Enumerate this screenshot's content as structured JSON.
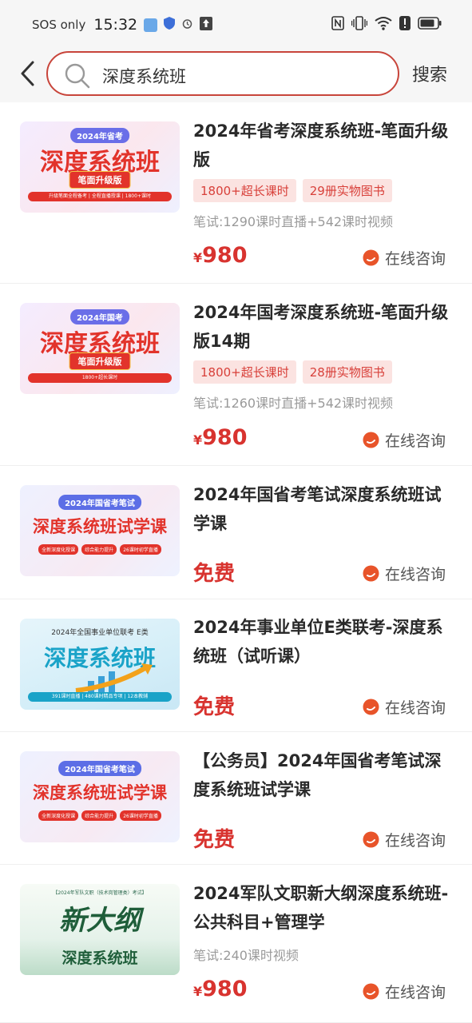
{
  "status_bar": {
    "carrier": "SOS only",
    "time": "15:32"
  },
  "search": {
    "query": "深度系统班",
    "button": "搜索"
  },
  "courses": [
    {
      "title": "2024年省考深度系统班-笔面升级版",
      "tags": [
        "1800+超长课时",
        "29册实物图书"
      ],
      "desc": "笔试:1290课时直播+542课时视频",
      "price_symbol": "¥",
      "price": "980",
      "consult": "在线咨询",
      "thumb": {
        "badge": "2024年省考",
        "headline": "深度系统班",
        "ribbon": "笔面升级版",
        "strip": "升级笔面全程备考 | 全程直播授课 | 1800+课时"
      }
    },
    {
      "title": "2024年国考深度系统班-笔面升级版14期",
      "tags": [
        "1800+超长课时",
        "28册实物图书"
      ],
      "desc": "笔试:1260课时直播+542课时视频",
      "price_symbol": "¥",
      "price": "980",
      "consult": "在线咨询",
      "thumb": {
        "badge": "2024年国考",
        "headline": "深度系统班",
        "ribbon": "笔面升级版",
        "strip": "1800+超长课时"
      }
    },
    {
      "title": "2024年国省考笔试深度系统班试学课",
      "price": "免费",
      "consult": "在线咨询",
      "thumb": {
        "badge": "2024年国省考笔试",
        "headline": "深度系统班试学课",
        "pills": [
          "全新深度化授课",
          "综合能力提升",
          "26课时初学直播"
        ]
      }
    },
    {
      "title": "2024年事业单位E类联考-深度系统班（试听课）",
      "price": "免费",
      "consult": "在线咨询",
      "thumb": {
        "badge": "2024年全国事业单位联考 E类",
        "headline": "深度系统班",
        "strip": "391课时直播 | 480课时精品专项 | 12本教辅"
      }
    },
    {
      "title": "【公务员】2024年国省考笔试深度系统班试学课",
      "price": "免费",
      "consult": "在线咨询",
      "thumb": {
        "badge": "2024年国省考笔试",
        "headline": "深度系统班试学课",
        "pills": [
          "全新深度化授课",
          "综合能力提升",
          "26课时初学直播"
        ]
      }
    },
    {
      "title": "2024军队文职新大纲深度系统班-公共科目+管理学",
      "desc": "笔试:240课时视频",
      "price_symbol": "¥",
      "price": "980",
      "consult": "在线咨询",
      "thumb": {
        "badge": "【2024年军队文职（技术岗管理类）考试】",
        "headline": "新大纲",
        "sub": "深度系统班"
      }
    }
  ],
  "colors": {
    "accent": "#d8332f",
    "tag_bg": "#fbe3e1",
    "search_border": "#c8453b",
    "consult_icon": "#e8542a"
  }
}
